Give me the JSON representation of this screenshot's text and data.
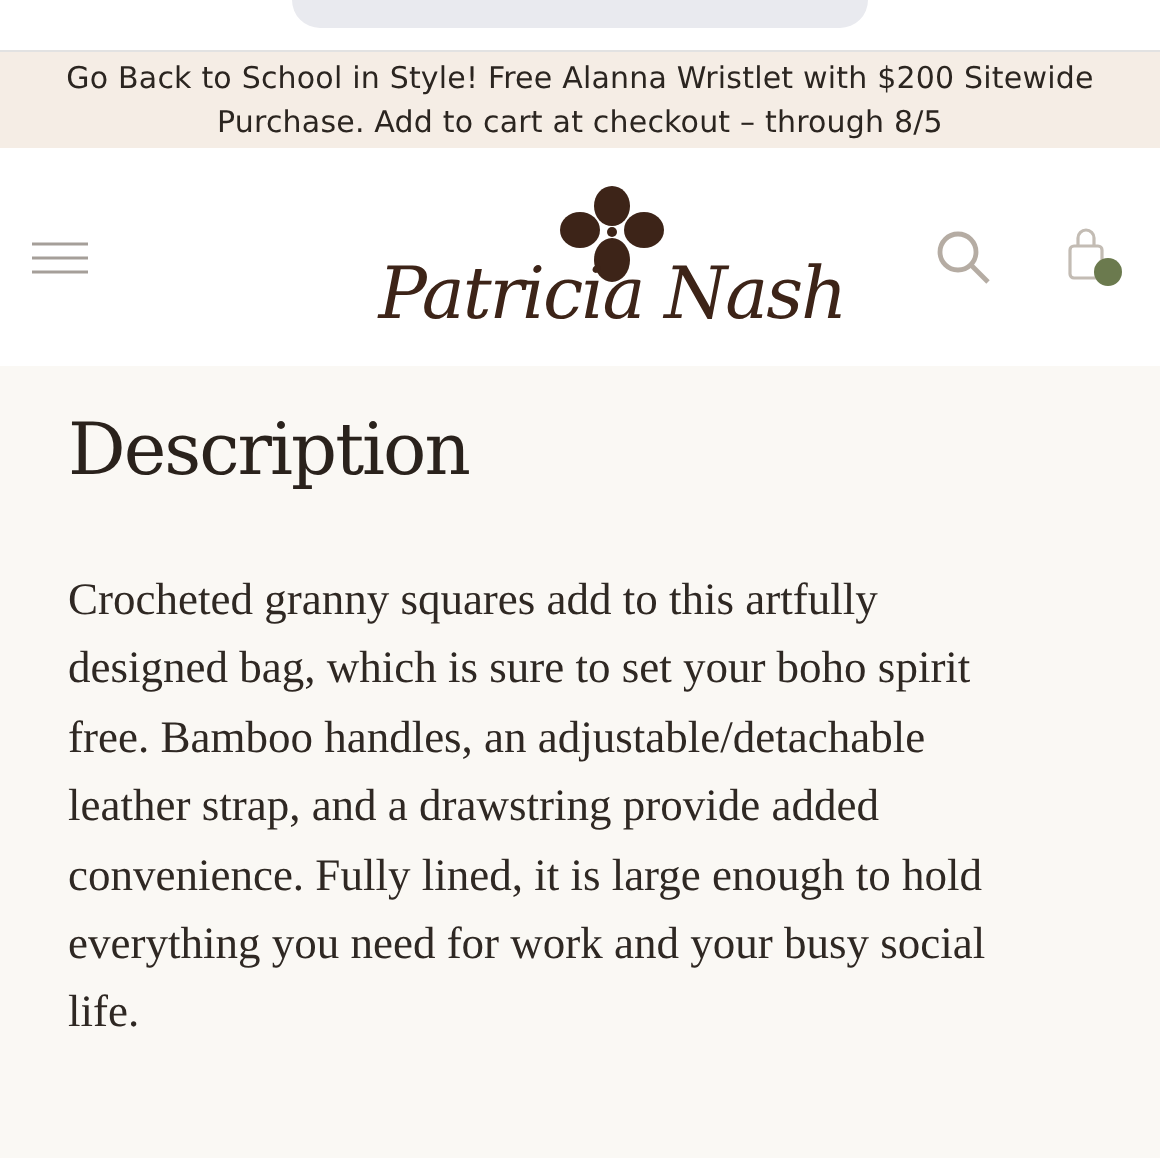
{
  "promo_banner": {
    "text": "Go Back to School in Style! Free Alanna Wristlet with $200 Sitewide Purchase. Add to cart at checkout – through 8/5"
  },
  "header": {
    "logo_text": "Patricia Nash"
  },
  "description": {
    "heading": "Description",
    "body": "Crocheted granny squares add to this artfully designed bag, which is sure to set your boho spirit free. Bamboo handles, an adjustable/detachable leather strap, and a drawstring provide added convenience. Fully lined, it is large enough to hold everything you need for work and your busy social life."
  }
}
